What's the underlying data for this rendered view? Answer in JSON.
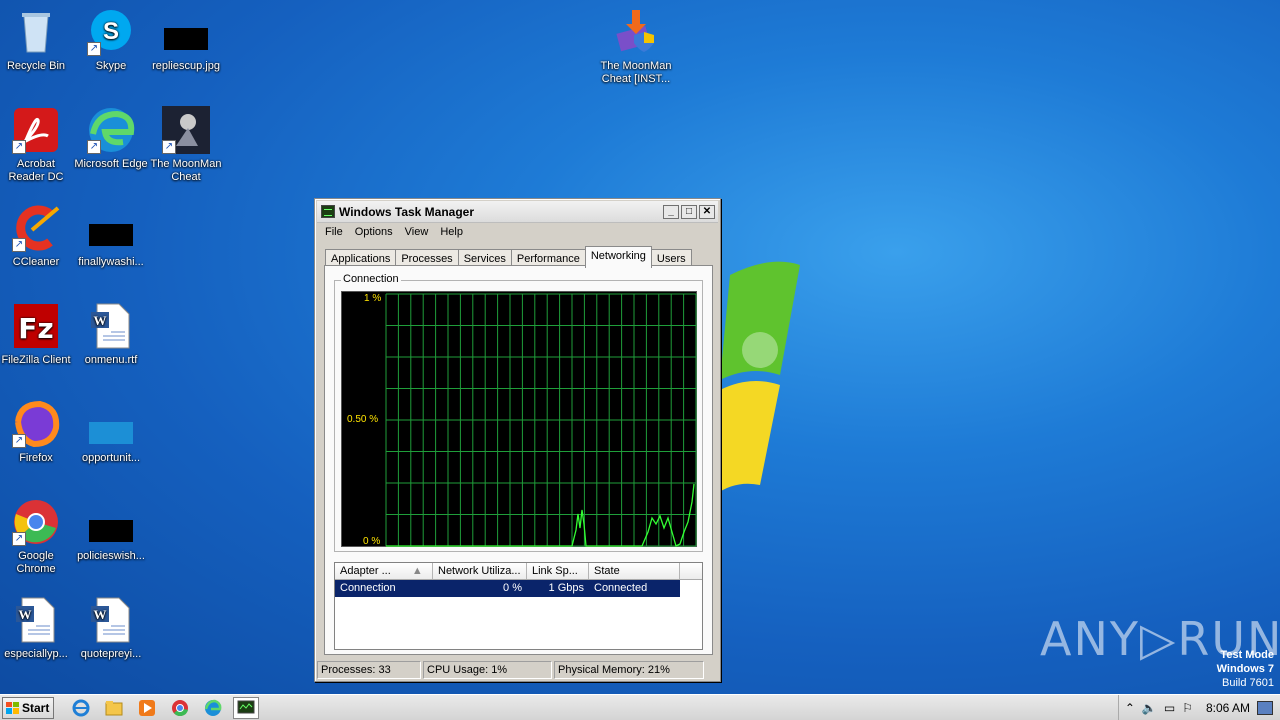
{
  "desktop": {
    "icons": [
      {
        "label": "Recycle Bin"
      },
      {
        "label": "Skype"
      },
      {
        "label": "repliescup.jpg"
      },
      {
        "label": "The MoonMan Cheat [INST..."
      },
      {
        "label": "Acrobat Reader DC"
      },
      {
        "label": "Microsoft Edge"
      },
      {
        "label": "The MoonMan Cheat"
      },
      {
        "label": "CCleaner"
      },
      {
        "label": "finallywashi..."
      },
      {
        "label": "FileZilla Client"
      },
      {
        "label": "onmenu.rtf"
      },
      {
        "label": "Firefox"
      },
      {
        "label": "opportunit..."
      },
      {
        "label": "Google Chrome"
      },
      {
        "label": "policieswish..."
      },
      {
        "label": "especiallyp..."
      },
      {
        "label": "quotepreyi..."
      }
    ]
  },
  "taskmgr": {
    "title": "Windows Task Manager",
    "menu": [
      "File",
      "Options",
      "View",
      "Help"
    ],
    "tabs": [
      "Applications",
      "Processes",
      "Services",
      "Performance",
      "Networking",
      "Users"
    ],
    "active_tab": "Networking",
    "group_label": "Connection",
    "graph": {
      "y_labels": [
        "1 %",
        "0.50 %",
        "0 %"
      ],
      "grid_color": "#1f9e3a",
      "line_color": "#33ff33"
    },
    "list": {
      "columns": [
        "Adapter ...",
        "Network Utiliza...",
        "Link Sp...",
        "State"
      ],
      "rows": [
        {
          "adapter": "Connection",
          "utilization": "0 %",
          "speed": "1 Gbps",
          "state": "Connected"
        }
      ]
    },
    "status": {
      "processes": "Processes: 33",
      "cpu": "CPU Usage: 1%",
      "memory": "Physical Memory: 21%"
    }
  },
  "watermark": {
    "brand": "ANY▷RUN",
    "mode": "Test Mode",
    "os": "Windows 7",
    "build": "Build 7601"
  },
  "taskbar": {
    "start_label": "Start",
    "clock": "8:06 AM"
  }
}
